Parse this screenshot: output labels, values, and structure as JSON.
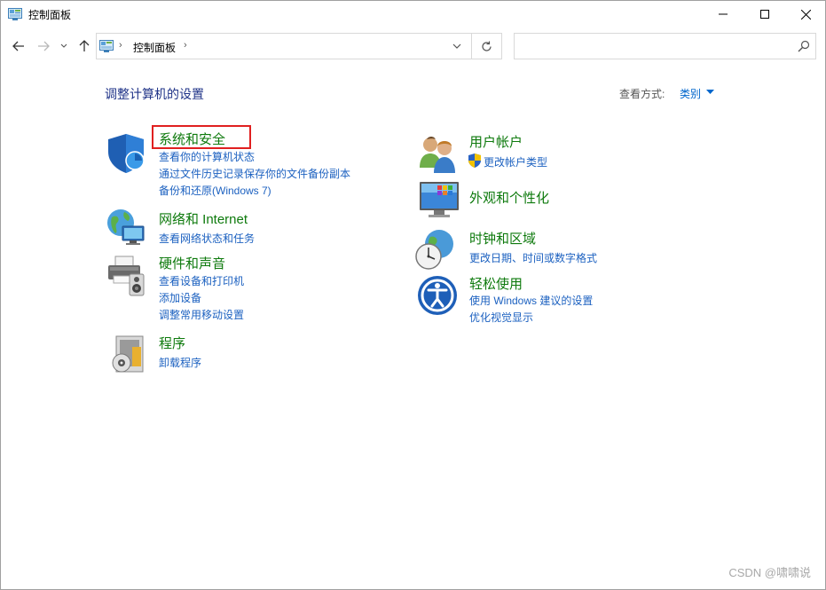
{
  "window": {
    "title": "控制面板",
    "controls": {
      "minimize": "—",
      "maximize": "☐",
      "close": "✕"
    }
  },
  "navigation": {
    "back_icon": "arrow-left-icon",
    "forward_icon": "arrow-right-icon",
    "history_icon": "chevron-down-icon",
    "up_icon": "arrow-up-icon",
    "breadcrumb": [
      "控制面板"
    ],
    "separator": "›",
    "search_placeholder": ""
  },
  "main": {
    "title": "调整计算机的设置",
    "view_by_label": "查看方式:",
    "view_by_value": "类别"
  },
  "categories": [
    {
      "name": "system-security",
      "title": "系统和安全",
      "icon": "shield-icon",
      "highlighted": true,
      "links": [
        "查看你的计算机状态",
        "通过文件历史记录保存你的文件备份副本",
        "备份和还原(Windows 7)"
      ]
    },
    {
      "name": "network-internet",
      "title": "网络和 Internet",
      "icon": "globe-network-icon",
      "links": [
        "查看网络状态和任务"
      ]
    },
    {
      "name": "hardware-sound",
      "title": "硬件和声音",
      "icon": "printer-speaker-icon",
      "links": [
        "查看设备和打印机",
        "添加设备",
        "调整常用移动设置"
      ]
    },
    {
      "name": "programs",
      "title": "程序",
      "icon": "programs-icon",
      "links": [
        "卸载程序"
      ]
    },
    {
      "name": "user-accounts",
      "title": "用户帐户",
      "icon": "users-icon",
      "links": [
        "更改帐户类型"
      ],
      "link_icon": "uac-shield-icon"
    },
    {
      "name": "appearance",
      "title": "外观和个性化",
      "icon": "monitor-palette-icon",
      "links": []
    },
    {
      "name": "clock-region",
      "title": "时钟和区域",
      "icon": "clock-globe-icon",
      "links": [
        "更改日期、时间或数字格式"
      ]
    },
    {
      "name": "ease-of-access",
      "title": "轻松使用",
      "icon": "ease-of-access-icon",
      "links": [
        "使用 Windows 建议的设置",
        "优化视觉显示"
      ]
    }
  ],
  "watermark": "CSDN @啸啸说",
  "colors": {
    "category_title": "#0e7a0d",
    "link": "#1c61c0",
    "page_title": "#1e3287",
    "highlight": "#e02020"
  }
}
